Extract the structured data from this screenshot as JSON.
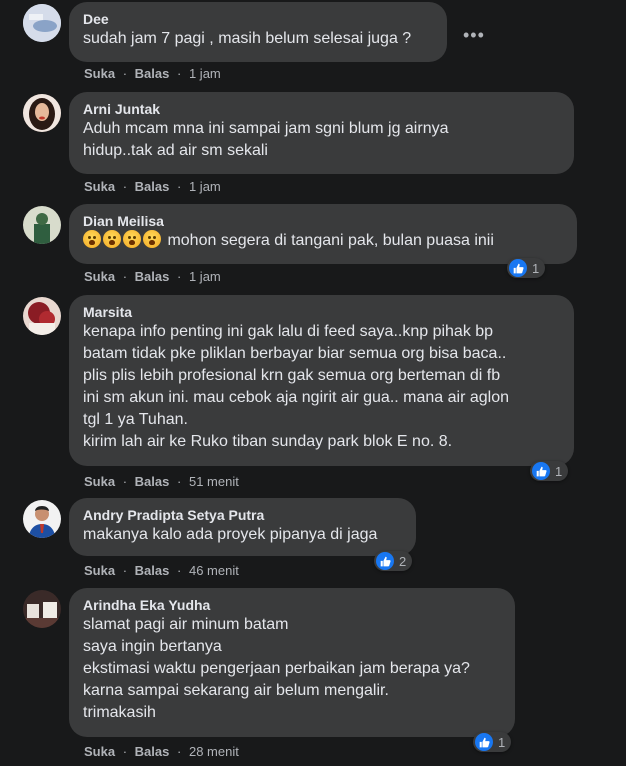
{
  "comments": [
    {
      "name": "Dee",
      "text": "sudah jam 7 pagi , masih belum selesai juga ?",
      "like": "Suka",
      "reply": "Balas",
      "time": "1 jam"
    },
    {
      "name": "Arni Juntak",
      "text": "Aduh mcam mna ini sampai jam sgni blum jg airnya\nhidup..tak ad air sm sekali",
      "like": "Suka",
      "reply": "Balas",
      "time": "1 jam"
    },
    {
      "name": "Dian Meilisa",
      "text": "mohon segera di tangani pak, bulan puasa inii",
      "like": "Suka",
      "reply": "Balas",
      "time": "1 jam",
      "reactions": "1"
    },
    {
      "name": "Marsita",
      "text": "kenapa info penting ini gak lalu di feed saya..knp pihak bp\nbatam tidak pke pliklan berbayar biar semua org bisa baca..\nplis plis lebih profesional krn gak semua org berteman di fb\nini sm akun ini. mau cebok aja ngirit air gua.. mana air aglon\ntgl 1 ya Tuhan.\nkirim lah air ke Ruko tiban sunday park blok E no. 8.",
      "like": "Suka",
      "reply": "Balas",
      "time": "51 menit",
      "reactions": "1"
    },
    {
      "name": "Andry Pradipta Setya Putra",
      "text": "makanya kalo ada proyek pipanya di jaga",
      "like": "Suka",
      "reply": "Balas",
      "time": "46 menit",
      "reactions": "2"
    },
    {
      "name": "Arindha Eka Yudha",
      "text": "slamat pagi air minum batam\nsaya ingin bertanya\nekstimasi waktu pengerjaan perbaikan jam berapa ya?\nkarna sampai sekarang air belum mengalir.\ntrimakasih",
      "like": "Suka",
      "reply": "Balas",
      "time": "28 menit",
      "reactions": "1"
    }
  ],
  "icons": {
    "more": "more-options-icon",
    "like": "like-thumb-icon",
    "emoji": "crying-face-emoji"
  },
  "colors": {
    "background": "#18191a",
    "bubble": "#3a3b3c",
    "like_blue": "#1877f2"
  },
  "separator": "·"
}
